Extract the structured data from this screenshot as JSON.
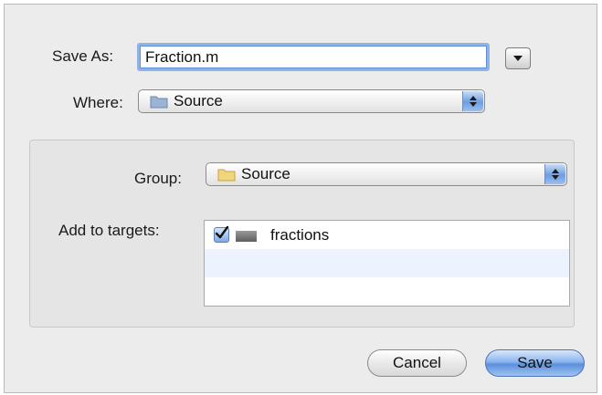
{
  "save_as": {
    "label": "Save As:",
    "value": "Fraction.m"
  },
  "where": {
    "label": "Where:",
    "selected": "Source"
  },
  "group": {
    "label": "Group:",
    "selected": "Source"
  },
  "targets": {
    "label": "Add to targets:",
    "items": [
      {
        "name": "fractions",
        "checked": true
      }
    ]
  },
  "buttons": {
    "cancel": "Cancel",
    "save": "Save"
  },
  "colors": {
    "focus_ring": "#8fb3e3",
    "default_button": "#5b90dc",
    "stripe_row": "#edf3fe"
  },
  "icons": {
    "disclosure": "triangle-down-icon",
    "folder": "folder-icon",
    "target": "target-icon",
    "checkbox": "checkmark-icon"
  }
}
